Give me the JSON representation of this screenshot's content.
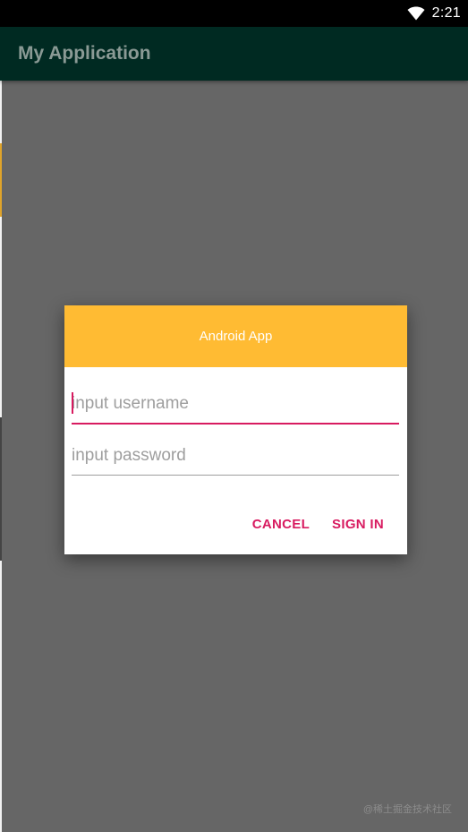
{
  "status_bar": {
    "time": "2:21",
    "wifi_icon": "wifi-icon"
  },
  "app_bar": {
    "title": "My Application"
  },
  "dialog": {
    "title": "Android App",
    "username_placeholder": "input username",
    "password_placeholder": "input password",
    "cancel_label": "CANCEL",
    "signin_label": "SIGN IN"
  },
  "watermark": "@稀土掘金技术社区",
  "colors": {
    "header": "#ffbb33",
    "accent": "#d81b60",
    "app_bar": "#002a22",
    "scrim": "#666666"
  }
}
